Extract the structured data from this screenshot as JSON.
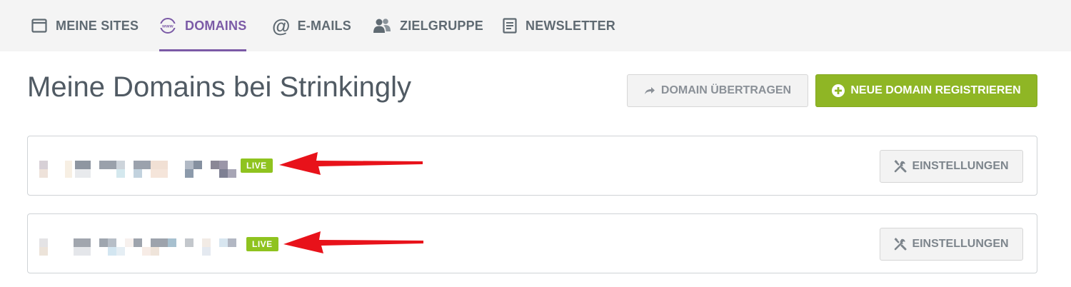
{
  "nav": {
    "tabs": [
      {
        "label": "MEINE SITES",
        "icon": "browser-window-icon",
        "active": false
      },
      {
        "label": "DOMAINS",
        "icon": "www-icon",
        "active": true
      },
      {
        "label": "E-MAILS",
        "icon": "at-sign-icon",
        "active": false
      },
      {
        "label": "ZIELGRUPPE",
        "icon": "users-icon",
        "active": false
      },
      {
        "label": "NEWSLETTER",
        "icon": "newsletter-icon",
        "active": false
      }
    ]
  },
  "page": {
    "title": "Meine Domains bei Strinkingly",
    "transfer_button": "DOMAIN ÜBERTRAGEN",
    "register_button": "NEUE DOMAIN REGISTRIEREN"
  },
  "domains": [
    {
      "name_blurred": true,
      "status": "LIVE",
      "settings_label": "EINSTELLUNGEN",
      "annotation": "red-arrow"
    },
    {
      "name_blurred": true,
      "status": "LIVE",
      "settings_label": "EINSTELLUNGEN",
      "annotation": "red-arrow"
    }
  ],
  "colors": {
    "accent_purple": "#7b5aa6",
    "brand_green": "#8fb625",
    "live_green": "#8fc31f",
    "annotation_red": "#e8121a"
  }
}
